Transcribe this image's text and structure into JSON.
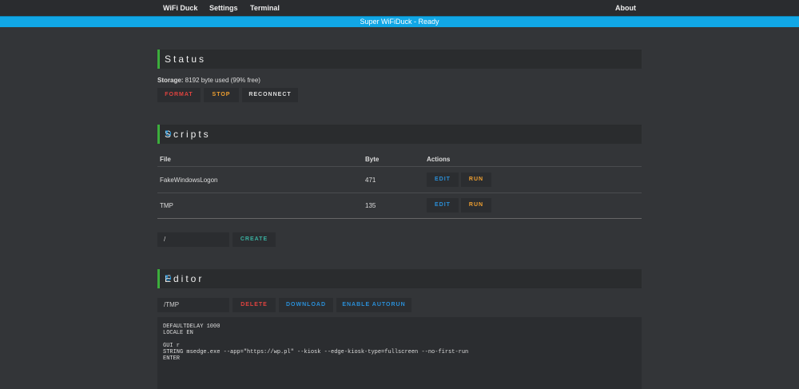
{
  "nav": {
    "items": [
      "WiFi Duck",
      "Settings",
      "Terminal"
    ],
    "about": "About"
  },
  "status_bar": "Super WiFiDuck - Ready",
  "status": {
    "title": "Status",
    "storage_label": "Storage:",
    "storage_value": " 8192 byte used (99% free)",
    "buttons": [
      "FORMAT",
      "STOP",
      "RECONNECT"
    ]
  },
  "scripts": {
    "title": "Scripts",
    "refresh_icon": "↻",
    "columns": [
      "File",
      "Byte",
      "Actions"
    ],
    "rows": [
      {
        "file": "FakeWindowsLogon",
        "byte": "471",
        "edit": "EDIT",
        "run": "RUN"
      },
      {
        "file": "TMP",
        "byte": "135",
        "edit": "EDIT",
        "run": "RUN"
      }
    ],
    "new_file_value": "/",
    "create": "CREATE"
  },
  "editor": {
    "title": "Editor",
    "refresh_icon": "↻",
    "filename": "/TMP",
    "delete": "DELETE",
    "download": "DOWNLOAD",
    "autorun": "ENABLE AUTORUN",
    "content": "DEFAULTDELAY 1000\nLOCALE EN\n\nGUI r\nSTRING msedge.exe --app=\"https://wp.pl\" --kiosk --edge-kiosk-type=fullscreen --no-first-run\nENTER"
  }
}
